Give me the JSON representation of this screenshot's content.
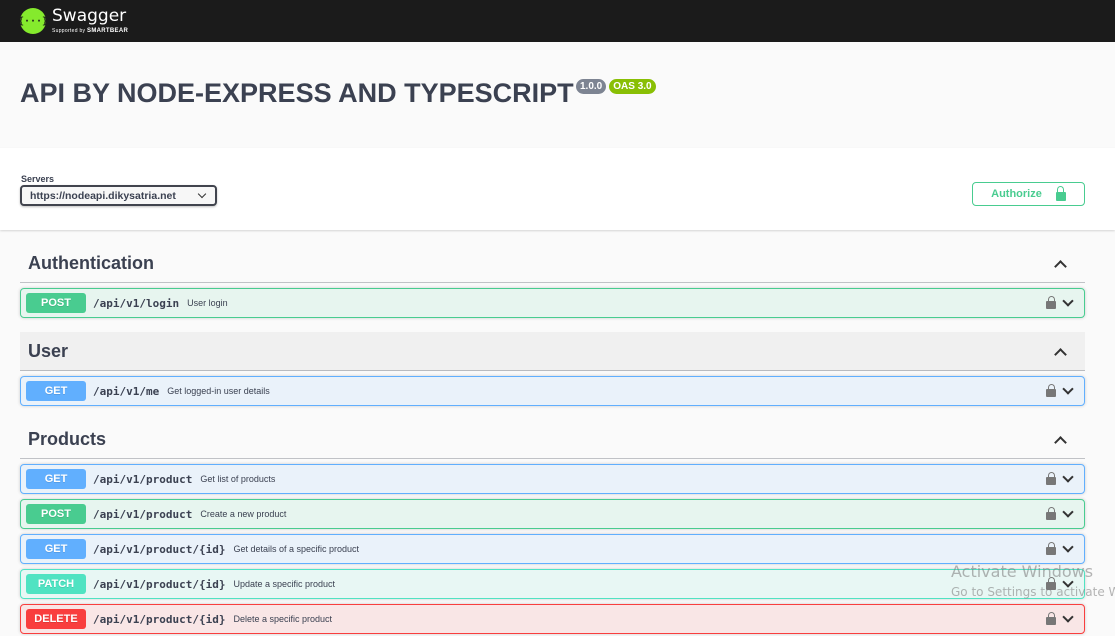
{
  "topbar": {
    "brand": "Swagger",
    "supported_by": "Supported by",
    "company": "SMARTBEAR",
    "logo_glyph": "{···}"
  },
  "info": {
    "title": "API BY NODE-EXPRESS AND TYPESCRIPT",
    "version": "1.0.0",
    "oas": "OAS 3.0"
  },
  "scheme": {
    "servers_label": "Servers",
    "server_value": "https://nodeapi.dikysatria.net",
    "authorize_label": "Authorize"
  },
  "tags": [
    {
      "name": "Authentication",
      "ops": [
        {
          "method": "POST",
          "path": "/api/v1/login",
          "summary": "User login"
        }
      ]
    },
    {
      "name": "User",
      "ops": [
        {
          "method": "GET",
          "path": "/api/v1/me",
          "summary": "Get logged-in user details"
        }
      ]
    },
    {
      "name": "Products",
      "ops": [
        {
          "method": "GET",
          "path": "/api/v1/product",
          "summary": "Get list of products"
        },
        {
          "method": "POST",
          "path": "/api/v1/product",
          "summary": "Create a new product"
        },
        {
          "method": "GET",
          "path": "/api/v1/product/{id}",
          "summary": "Get details of a specific product"
        },
        {
          "method": "PATCH",
          "path": "/api/v1/product/{id}",
          "summary": "Update a specific product"
        },
        {
          "method": "DELETE",
          "path": "/api/v1/product/{id}",
          "summary": "Delete a specific product"
        }
      ]
    }
  ],
  "watermark": {
    "title": "Activate Windows",
    "subtitle": "Go to Settings to activate Windows."
  },
  "colors": {
    "post": "#49cc90",
    "get": "#61affe",
    "patch": "#50e3c2",
    "delete": "#f93e3e",
    "topbar": "#1b1b1b",
    "logo": "#85ea2d"
  }
}
